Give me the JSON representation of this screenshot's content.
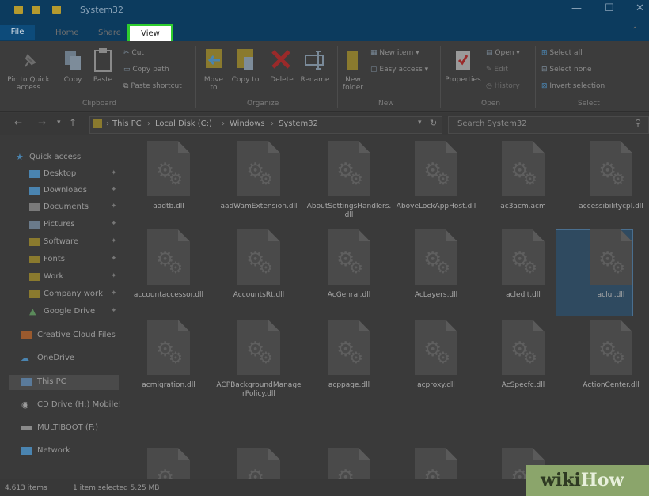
{
  "window": {
    "title": "System32",
    "minimize": "—",
    "maximize": "☐",
    "close": "✕"
  },
  "tabs": {
    "file": "File",
    "home": "Home",
    "share": "Share",
    "view": "View"
  },
  "ribbon": {
    "clipboard": {
      "group": "Clipboard",
      "pin": "Pin to Quick access",
      "copy": "Copy",
      "paste": "Paste",
      "cut": "Cut",
      "copy_path": "Copy path",
      "paste_shortcut": "Paste shortcut"
    },
    "organize": {
      "group": "Organize",
      "move_to": "Move to",
      "copy_to": "Copy to",
      "delete": "Delete",
      "rename": "Rename"
    },
    "new": {
      "group": "New",
      "new_folder": "New folder",
      "new_item": "New item ▾",
      "easy_access": "Easy access ▾"
    },
    "open": {
      "group": "Open",
      "properties": "Properties",
      "open": "Open ▾",
      "edit": "Edit",
      "history": "History"
    },
    "select": {
      "group": "Select",
      "select_all": "Select all",
      "select_none": "Select none",
      "invert": "Invert selection"
    }
  },
  "address": {
    "crumbs": [
      "This PC",
      "Local Disk (C:)",
      "Windows",
      "System32"
    ],
    "search_placeholder": "Search System32"
  },
  "nav": {
    "quick_access": "Quick access",
    "items": [
      {
        "label": "Desktop"
      },
      {
        "label": "Downloads"
      },
      {
        "label": "Documents"
      },
      {
        "label": "Pictures"
      },
      {
        "label": "Software"
      },
      {
        "label": "Fonts"
      },
      {
        "label": "Work"
      },
      {
        "label": "Company work"
      },
      {
        "label": "Google Drive"
      }
    ],
    "creative_cloud": "Creative Cloud Files",
    "onedrive": "OneDrive",
    "this_pc": "This PC",
    "cd_drive": "CD Drive (H:) Mobile!",
    "multiboot": "MULTIBOOT (F:)",
    "network": "Network"
  },
  "files": [
    "aadtb.dll",
    "aadWamExtension.dll",
    "AboutSettingsHandlers.dll",
    "AboveLockAppHost.dll",
    "ac3acm.acm",
    "accessibilitycpl.dll",
    "accountaccessor.dll",
    "AccountsRt.dll",
    "AcGenral.dll",
    "AcLayers.dll",
    "acledit.dll",
    "aclui.dll",
    "acmigration.dll",
    "ACPBackgroundManagerPolicy.dll",
    "acppage.dll",
    "acproxy.dll",
    "AcSpecfc.dll",
    "ActionCenter.dll"
  ],
  "status": {
    "count": "4,613 items",
    "selected": "1 item selected  5.25 MB"
  },
  "watermark": {
    "wiki": "wiki",
    "how": "How"
  }
}
